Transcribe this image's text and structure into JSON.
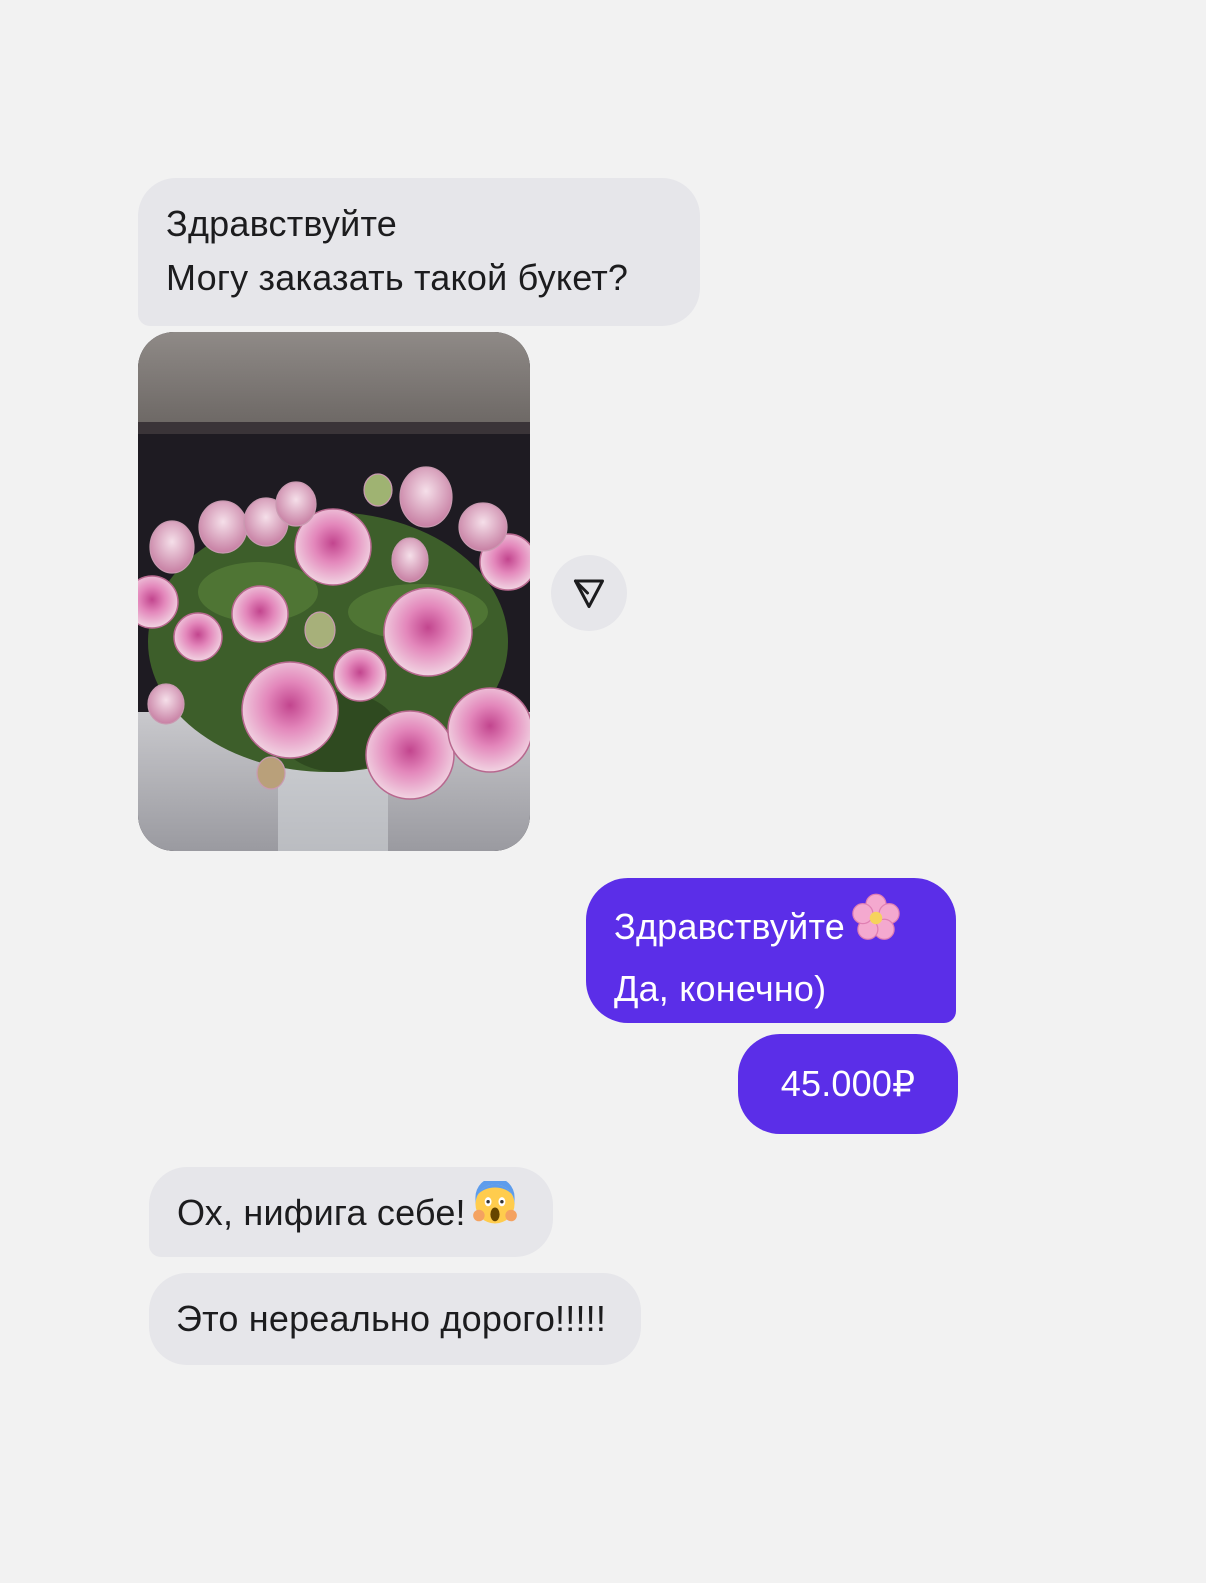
{
  "conversation": {
    "messages": [
      {
        "direction": "incoming",
        "lines": [
          "Здравствуйте",
          "Могу заказать такой букет?"
        ]
      },
      {
        "direction": "incoming",
        "type": "photo",
        "icon": "forward-icon"
      },
      {
        "direction": "outgoing",
        "lines": [
          "Здравствуйте",
          "Да, конечно)"
        ],
        "emoji": "cherry-blossom-emoji"
      },
      {
        "direction": "outgoing",
        "text": "45.000₽"
      },
      {
        "direction": "incoming",
        "text": "Ох, нифига себе!",
        "emoji": "screaming-face-emoji"
      },
      {
        "direction": "incoming",
        "text": "Это нереально дорого!!!!!"
      }
    ]
  },
  "colors": {
    "background": "#f2f2f2",
    "incoming_bubble": "#e6e6ea",
    "outgoing_bubble": "#5b2ee8"
  }
}
